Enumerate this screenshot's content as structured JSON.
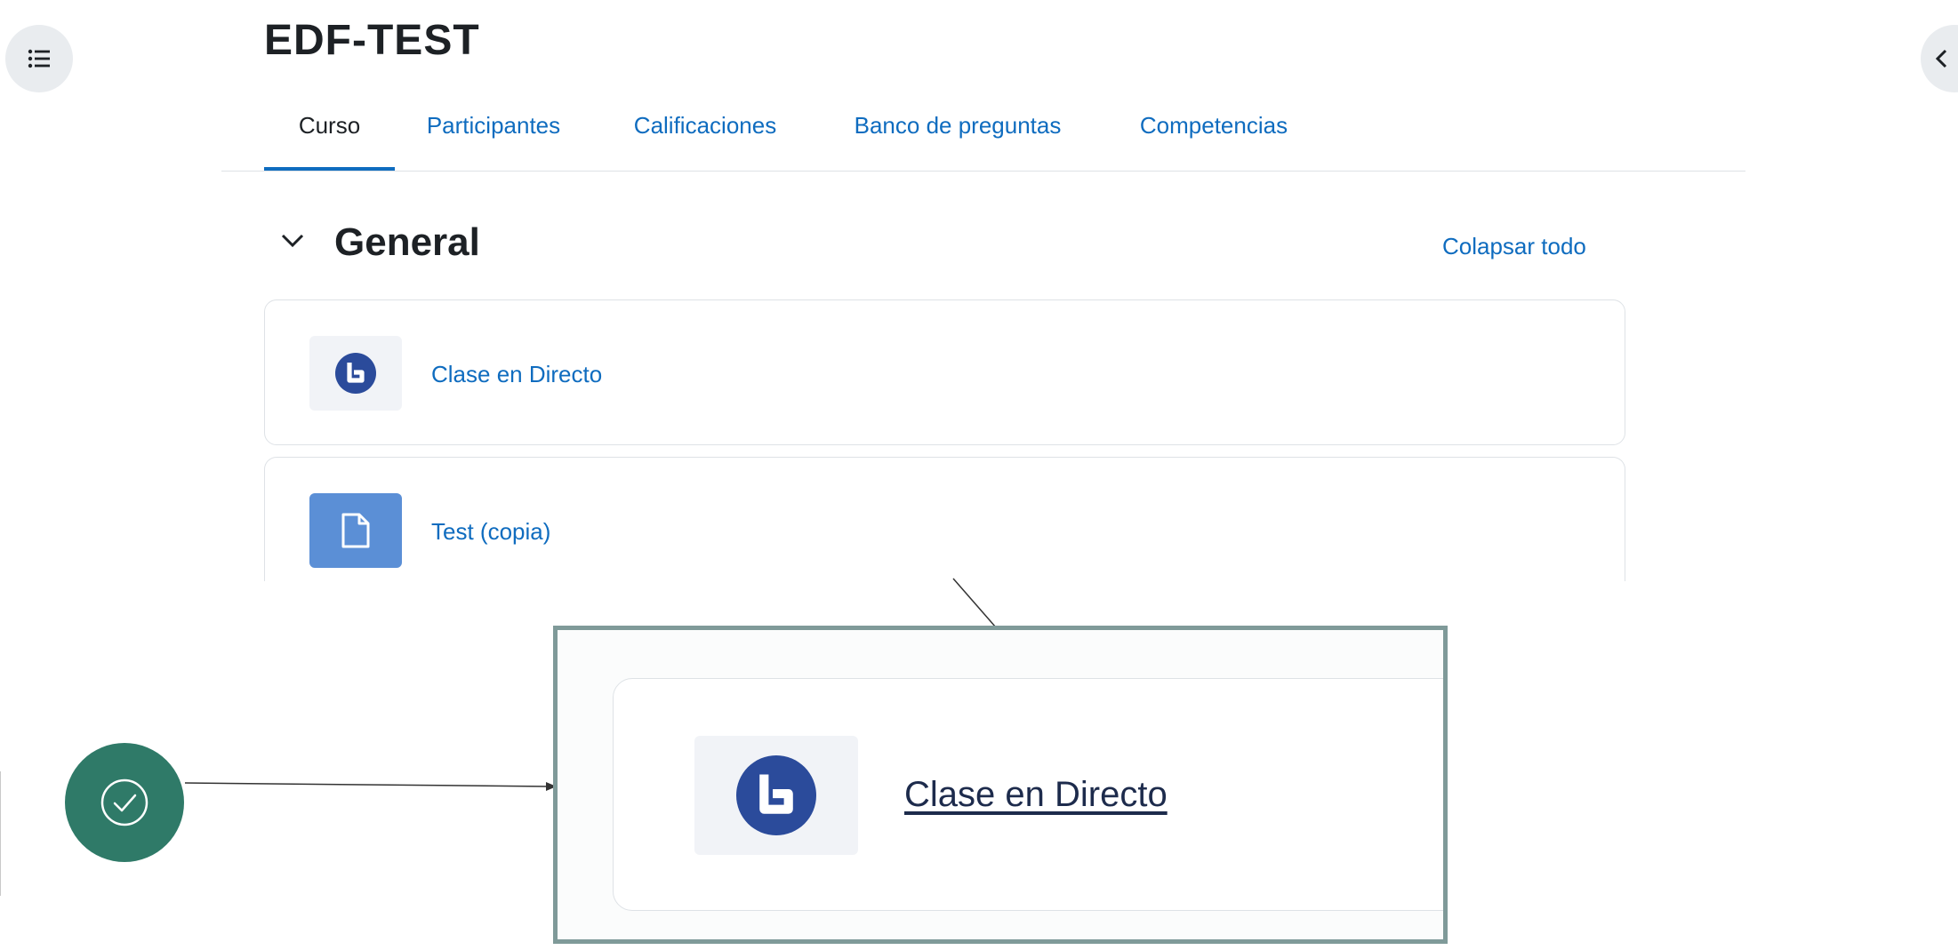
{
  "course": {
    "title": "EDF-TEST"
  },
  "tabs": [
    {
      "label": "Curso",
      "active": true
    },
    {
      "label": "Participantes",
      "active": false
    },
    {
      "label": "Calificaciones",
      "active": false
    },
    {
      "label": "Banco de preguntas",
      "active": false
    },
    {
      "label": "Competencias",
      "active": false
    }
  ],
  "section": {
    "title": "General",
    "collapse_all_label": "Colapsar todo"
  },
  "activities": [
    {
      "name": "Clase en Directo",
      "icon": "bigbluebutton-icon"
    },
    {
      "name": "Test (copia)",
      "icon": "file-icon"
    }
  ],
  "zoom": {
    "activity_name": "Clase en Directo",
    "icon": "bigbluebutton-icon"
  },
  "badge": {
    "icon": "check-circle-icon"
  },
  "colors": {
    "link": "#0f6cbf",
    "bbb_blue": "#2b4b9b",
    "file_tile": "#5b8fd6",
    "badge_green": "#2f7a68",
    "zoom_border": "#7f9a99"
  }
}
